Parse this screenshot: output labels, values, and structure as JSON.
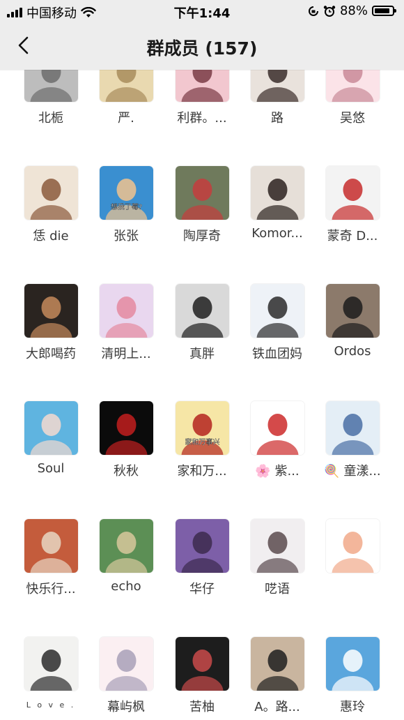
{
  "status_bar": {
    "carrier": "中国移动",
    "time": "下午1:44",
    "battery": "88%",
    "battery_level": 0.88,
    "icons": [
      "signal-icon",
      "wifi-icon",
      "rotation-lock-icon",
      "alarm-icon",
      "battery-icon"
    ]
  },
  "nav": {
    "title": "群成员 (157)",
    "back_icon": "chevron-left-icon"
  },
  "members": [
    {
      "name": "北栀",
      "colors": [
        "#bdbdbd",
        "#6d6d6d"
      ]
    },
    {
      "name": "严.",
      "colors": [
        "#e9d9b0",
        "#a88c5c"
      ]
    },
    {
      "name": "利群。...",
      "colors": [
        "#f2c7cf",
        "#7a3b45"
      ]
    },
    {
      "name": "路",
      "colors": [
        "#e9e2dc",
        "#3a2d2a"
      ]
    },
    {
      "name": "吴悠",
      "colors": [
        "#fbe3e8",
        "#c98a98"
      ]
    },
    {
      "name": "恁 die",
      "colors": [
        "#efe4d6",
        "#8b5a3c"
      ]
    },
    {
      "name": "张张",
      "colors": [
        "#3a8fd0",
        "#f1c38e"
      ],
      "overlay": "想我了莓?"
    },
    {
      "name": "陶厚奇",
      "colors": [
        "#6f7a5c",
        "#c53d3d"
      ]
    },
    {
      "name": "Komor...",
      "colors": [
        "#e6dfd8",
        "#2b2220"
      ]
    },
    {
      "name": "蒙奇 D...",
      "colors": [
        "#f3f3f3",
        "#c62c2c"
      ]
    },
    {
      "name": "大郎喝药",
      "colors": [
        "#2a2420",
        "#c48a5c"
      ]
    },
    {
      "name": "清明上...",
      "colors": [
        "#e9d7ef",
        "#e48aa0"
      ]
    },
    {
      "name": "真胖",
      "colors": [
        "#d9d9d9",
        "#1e1e1e"
      ]
    },
    {
      "name": "铁血团妈",
      "colors": [
        "#eef2f7",
        "#2c2c2c"
      ]
    },
    {
      "name": "Ordos",
      "colors": [
        "#8c7a6b",
        "#1c1c1c"
      ]
    },
    {
      "name": "Soul",
      "colors": [
        "#5fb4e0",
        "#f4d9cf"
      ]
    },
    {
      "name": "秋秋",
      "colors": [
        "#0b0b0b",
        "#c21f1f"
      ]
    },
    {
      "name": "家和万...",
      "colors": [
        "#f6e6a6",
        "#b4231f"
      ],
      "overlay": "家和万事兴"
    },
    {
      "name": "🌸 紫...",
      "colors": [
        "#ffffff",
        "#cc2a2a"
      ]
    },
    {
      "name": "🍭 童漾...",
      "colors": [
        "#e4eef6",
        "#4a6fa5"
      ]
    },
    {
      "name": "快乐行...",
      "colors": [
        "#c45c3c",
        "#e8d6c2"
      ]
    },
    {
      "name": "echo",
      "colors": [
        "#5c8f55",
        "#d7c89c"
      ]
    },
    {
      "name": "华仔",
      "colors": [
        "#7d5fa8",
        "#3c2a4e"
      ]
    },
    {
      "name": "呓语",
      "colors": [
        "#f1eef0",
        "#5a4a4e"
      ]
    },
    {
      "name": "",
      "colors": [
        "#ffffff",
        "#f1a98a"
      ]
    },
    {
      "name": "L o v e .",
      "colors": [
        "#f2f2f0",
        "#2b2b2b"
      ],
      "small": true
    },
    {
      "name": "幕屿枫",
      "colors": [
        "#fbeff2",
        "#a8a0b8"
      ]
    },
    {
      "name": "苦柚",
      "colors": [
        "#1d1d1d",
        "#c94a4a"
      ]
    },
    {
      "name": "A。路...",
      "colors": [
        "#c9b59f",
        "#1f1f1f"
      ]
    },
    {
      "name": "惠玲",
      "colors": [
        "#5aa6dd",
        "#ffffff"
      ]
    }
  ]
}
